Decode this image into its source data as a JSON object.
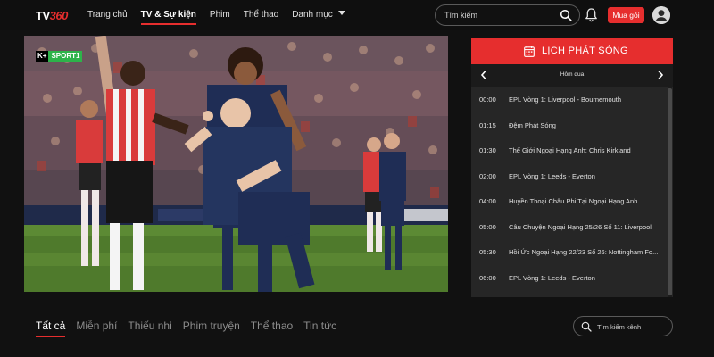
{
  "header": {
    "logo_text": "TV",
    "logo_accent": "360",
    "nav": [
      {
        "label": "Trang chủ",
        "active": false
      },
      {
        "label": "TV & Sự kiện",
        "active": true
      },
      {
        "label": "Phim",
        "active": false
      },
      {
        "label": "Thể thao",
        "active": false
      },
      {
        "label": "Danh mục",
        "active": false,
        "dropdown": true
      }
    ],
    "search_placeholder": "Tìm kiếm",
    "buy_label": "Mua gói",
    "icons": {
      "search": "search-icon",
      "notifications": "bell-icon",
      "profile": "user-avatar-icon"
    }
  },
  "player": {
    "channel_badge_k": "K+",
    "channel_badge_name": "SPORT1"
  },
  "schedule": {
    "title": "LỊCH PHÁT SÓNG",
    "day_label": "Hôm qua",
    "items": [
      {
        "time": "00:00",
        "name": "EPL Vòng 1: Liverpool - Bournemouth"
      },
      {
        "time": "01:15",
        "name": "Đệm Phát Sóng"
      },
      {
        "time": "01:30",
        "name": "Thế Giới Ngoại Hạng Anh: Chris Kirkland"
      },
      {
        "time": "02:00",
        "name": "EPL Vòng 1: Leeds - Everton"
      },
      {
        "time": "04:00",
        "name": "Huyền Thoại Châu Phi Tại Ngoại Hạng Anh"
      },
      {
        "time": "05:00",
        "name": "Câu Chuyện Ngoại Hạng 25/26 Số 11: Liverpool"
      },
      {
        "time": "05:30",
        "name": "Hồi Ức Ngoại Hạng 22/23 Số 26: Nottingham Fo..."
      },
      {
        "time": "06:00",
        "name": "EPL Vòng 1: Leeds - Everton"
      }
    ]
  },
  "tabs": [
    {
      "label": "Tất cả",
      "active": true
    },
    {
      "label": "Miễn phí",
      "active": false
    },
    {
      "label": "Thiếu nhi",
      "active": false
    },
    {
      "label": "Phim truyện",
      "active": false
    },
    {
      "label": "Thể thao",
      "active": false
    },
    {
      "label": "Tin tức",
      "active": false
    }
  ],
  "channel_search_placeholder": "Tìm kiếm kênh",
  "colors": {
    "accent": "#e62e2e",
    "background": "#111111",
    "panel": "#262626",
    "badge_green": "#2db34a"
  }
}
